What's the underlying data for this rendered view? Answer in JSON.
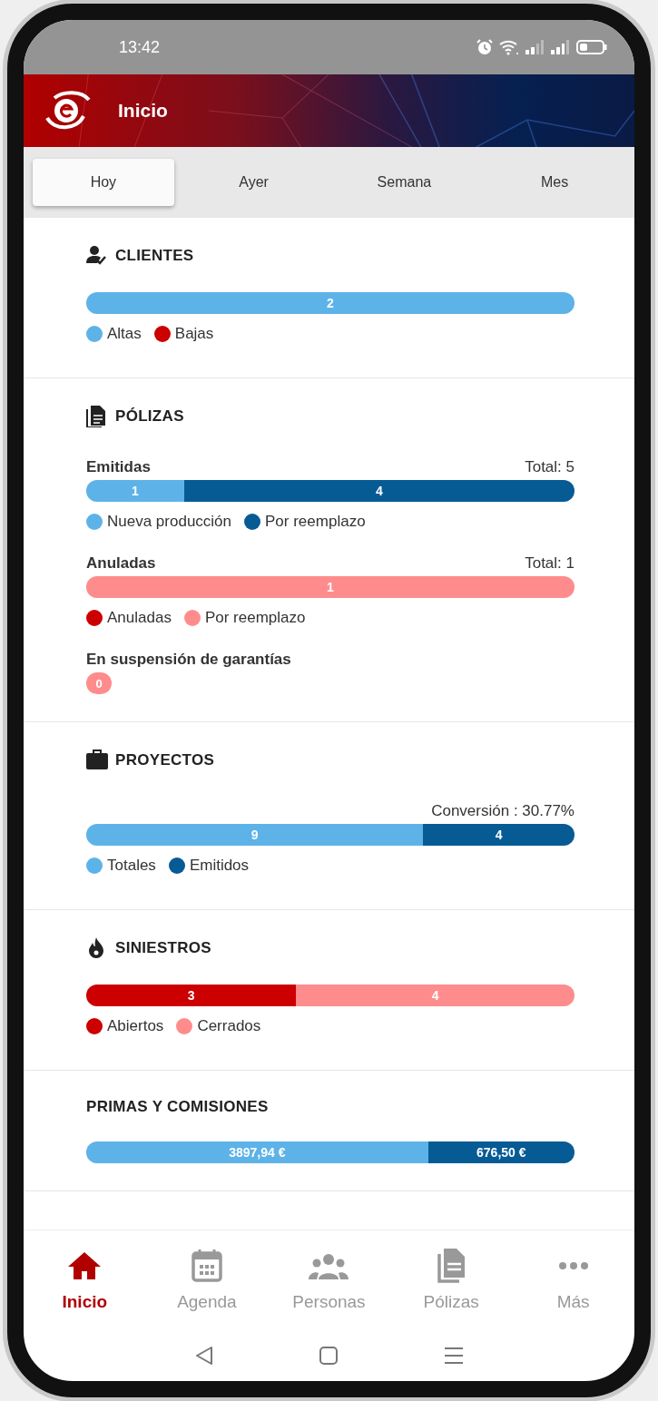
{
  "status_bar": {
    "time": "13:42"
  },
  "header": {
    "title": "Inicio"
  },
  "tabs": [
    {
      "label": "Hoy",
      "selected": true
    },
    {
      "label": "Ayer",
      "selected": false
    },
    {
      "label": "Semana",
      "selected": false
    },
    {
      "label": "Mes",
      "selected": false
    }
  ],
  "sections": [
    {
      "title": "CLIENTES",
      "blocks": [
        {
          "kind": "bar",
          "segments": [
            {
              "label": "2",
              "level": 1,
              "color": "#5db3e8"
            }
          ],
          "legend": [
            {
              "label": "Altas",
              "color": "#5db3e8"
            },
            {
              "label": "Bajas",
              "color": "#cc0000"
            }
          ]
        }
      ]
    },
    {
      "title": "PÓLIZAS",
      "blocks": [
        {
          "kind": "bar",
          "label": "Emitidas",
          "total": "Total: 5",
          "segments": [
            {
              "label": "1",
              "level": 0.2,
              "color": "#5db3e8"
            },
            {
              "label": "4",
              "level": 0.8,
              "color": "#065b95"
            }
          ],
          "legend": [
            {
              "label": "Nueva producción",
              "color": "#5db3e8"
            },
            {
              "label": "Por reemplazo",
              "color": "#065b95"
            }
          ]
        },
        {
          "kind": "bar",
          "label": "Anuladas",
          "total": "Total: 1",
          "segments": [
            {
              "label": "1",
              "level": 1,
              "color": "#ff8c8c"
            }
          ],
          "legend": [
            {
              "label": "Anuladas",
              "color": "#cc0000"
            },
            {
              "label": "Por reemplazo",
              "color": "#ff8c8c"
            }
          ]
        },
        {
          "kind": "badge",
          "label": "En suspensión de garantías",
          "value": "0",
          "color": "#ff8c8c"
        }
      ]
    },
    {
      "title": "PROYECTOS",
      "blocks": [
        {
          "kind": "bar",
          "total": "Conversión : 30.77%",
          "segments": [
            {
              "label": "9",
              "level": 0.69,
              "color": "#5db3e8"
            },
            {
              "label": "4",
              "level": 0.31,
              "color": "#065b95"
            }
          ],
          "legend": [
            {
              "label": "Totales",
              "color": "#5db3e8"
            },
            {
              "label": "Emitidos",
              "color": "#065b95"
            }
          ]
        }
      ]
    },
    {
      "title": "SINIESTROS",
      "blocks": [
        {
          "kind": "bar",
          "segments": [
            {
              "label": "3",
              "level": 0.43,
              "color": "#cc0000"
            },
            {
              "label": "4",
              "level": 0.57,
              "color": "#ff8c8c"
            }
          ],
          "legend": [
            {
              "label": "Abiertos",
              "color": "#cc0000"
            },
            {
              "label": "Cerrados",
              "color": "#ff8c8c"
            }
          ]
        }
      ]
    },
    {
      "title": "PRIMAS Y COMISIONES",
      "blocks": [
        {
          "kind": "bar",
          "segments": [
            {
              "label": "3897,94 €",
              "level": 0.7,
              "color": "#5db3e8"
            },
            {
              "label": "676,50 €",
              "level": 0.3,
              "color": "#065b95"
            }
          ]
        }
      ]
    }
  ],
  "bottom_nav": [
    {
      "label": "Inicio",
      "selected": true
    },
    {
      "label": "Agenda",
      "selected": false
    },
    {
      "label": "Personas",
      "selected": false
    },
    {
      "label": "Pólizas",
      "selected": false
    },
    {
      "label": "Más",
      "selected": false
    }
  ]
}
